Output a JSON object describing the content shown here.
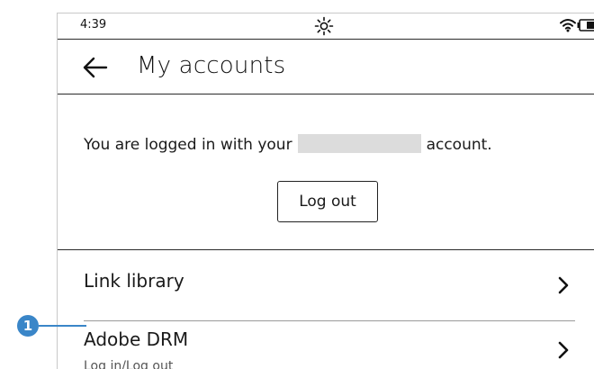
{
  "status_bar": {
    "time": "4:39",
    "icons": [
      "frontlight-icon",
      "wifi-icon",
      "battery-icon"
    ]
  },
  "header": {
    "back_icon": "back-arrow-icon",
    "title": "My accounts"
  },
  "account": {
    "message_prefix": "You are logged in with your",
    "message_suffix": "account.",
    "logout_label": "Log out"
  },
  "list": {
    "items": [
      {
        "title": "Link library",
        "subtitle": "",
        "icon": "chevron-right-icon"
      },
      {
        "title": "Adobe DRM",
        "subtitle": "Log in/Log out",
        "icon": "chevron-right-icon"
      }
    ]
  },
  "callout": {
    "number": "1",
    "color": "#3a86c8"
  }
}
